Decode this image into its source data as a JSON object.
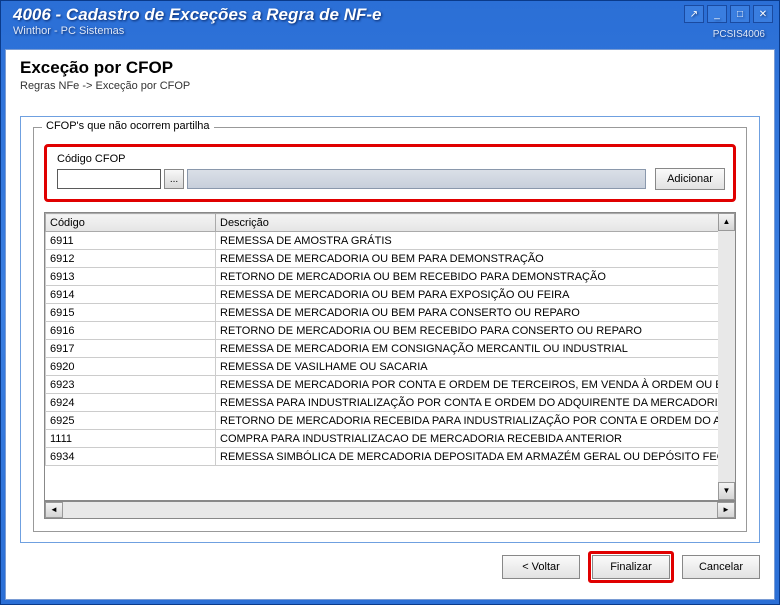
{
  "window": {
    "title": "4006 - Cadastro de Exceções a Regra de NF-e",
    "subtitle": "Winthor - PC Sistemas",
    "right_code": "PCSIS4006"
  },
  "header": {
    "title": "Exceção por CFOP",
    "breadcrumb": "Regras NFe -> Exceção por CFOP"
  },
  "fieldset": {
    "legend": "CFOP's que não ocorrem partilha",
    "code_label": "Código CFOP",
    "code_value": "",
    "lookup_label": "...",
    "add_label": "Adicionar"
  },
  "table": {
    "columns": {
      "code": "Código",
      "desc": "Descrição"
    },
    "rows": [
      {
        "code": "6911",
        "desc": "REMESSA DE AMOSTRA GRÁTIS"
      },
      {
        "code": "6912",
        "desc": "REMESSA DE MERCADORIA OU BEM PARA DEMONSTRAÇÃO"
      },
      {
        "code": "6913",
        "desc": "RETORNO DE MERCADORIA OU BEM RECEBIDO PARA DEMONSTRAÇÃO"
      },
      {
        "code": "6914",
        "desc": "REMESSA DE MERCADORIA OU BEM PARA EXPOSIÇÃO OU FEIRA"
      },
      {
        "code": "6915",
        "desc": "REMESSA DE MERCADORIA OU BEM PARA CONSERTO OU REPARO"
      },
      {
        "code": "6916",
        "desc": "RETORNO DE MERCADORIA OU BEM RECEBIDO PARA CONSERTO OU REPARO"
      },
      {
        "code": "6917",
        "desc": "REMESSA DE MERCADORIA EM CONSIGNAÇÃO MERCANTIL OU INDUSTRIAL"
      },
      {
        "code": "6920",
        "desc": "REMESSA DE VASILHAME OU SACARIA"
      },
      {
        "code": "6923",
        "desc": "REMESSA DE MERCADORIA POR CONTA E ORDEM DE TERCEIROS, EM VENDA À ORDEM OU EM OPERAÇÕES"
      },
      {
        "code": "6924",
        "desc": "REMESSA PARA INDUSTRIALIZAÇÃO POR CONTA E ORDEM DO ADQUIRENTE DA MERCADORIA, QUANDO ES"
      },
      {
        "code": "6925",
        "desc": "RETORNO DE MERCADORIA RECEBIDA PARA INDUSTRIALIZAÇÃO POR CONTA E ORDEM DO ADQUIRENTE D"
      },
      {
        "code": "1111",
        "desc": "COMPRA PARA INDUSTRIALIZACAO DE MERCADORIA RECEBIDA ANTERIOR"
      },
      {
        "code": "6934",
        "desc": "REMESSA SIMBÓLICA DE MERCADORIA DEPOSITADA EM ARMAZÉM GERAL OU DEPÓSITO FECHADO"
      }
    ]
  },
  "footer": {
    "back": "< Voltar",
    "finish": "Finalizar",
    "cancel": "Cancelar"
  }
}
